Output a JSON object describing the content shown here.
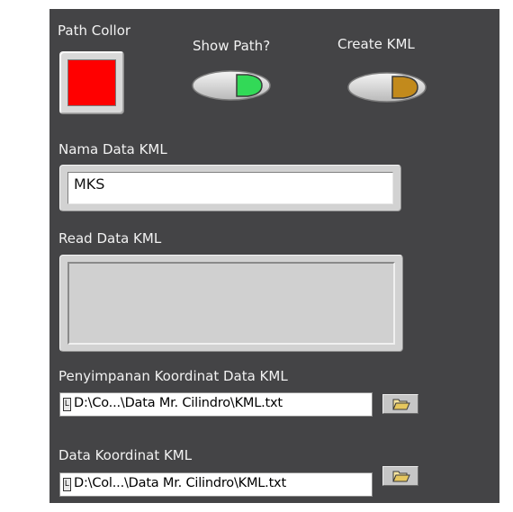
{
  "controls": {
    "path_color": {
      "label": "Path Collor",
      "value_color": "#ff0000"
    },
    "show_path": {
      "label": "Show Path?",
      "led_color": "#32d957",
      "state": "on"
    },
    "create_kml": {
      "label": "Create KML",
      "led_color": "#c28a1c",
      "state": "off"
    },
    "nama_data_kml": {
      "label": "Nama Data KML",
      "value": "MKS"
    },
    "read_data_kml": {
      "label": "Read Data KML",
      "value": ""
    },
    "penyimpanan": {
      "label": "Penyimpanan Koordinat Data KML",
      "path": "D:\\Co...\\Data Mr. Cilindro\\KML.txt",
      "icon": "path-type-icon",
      "browse_icon": "folder-open-icon"
    },
    "data_koordinat": {
      "label": "Data Koordinat KML",
      "path": "D:\\Col...\\Data Mr. Cilindro\\KML.txt",
      "icon": "path-type-icon",
      "browse_icon": "folder-open-icon"
    }
  },
  "colors": {
    "panel_bg": "#444446",
    "label_text": "#f2f2f2"
  }
}
